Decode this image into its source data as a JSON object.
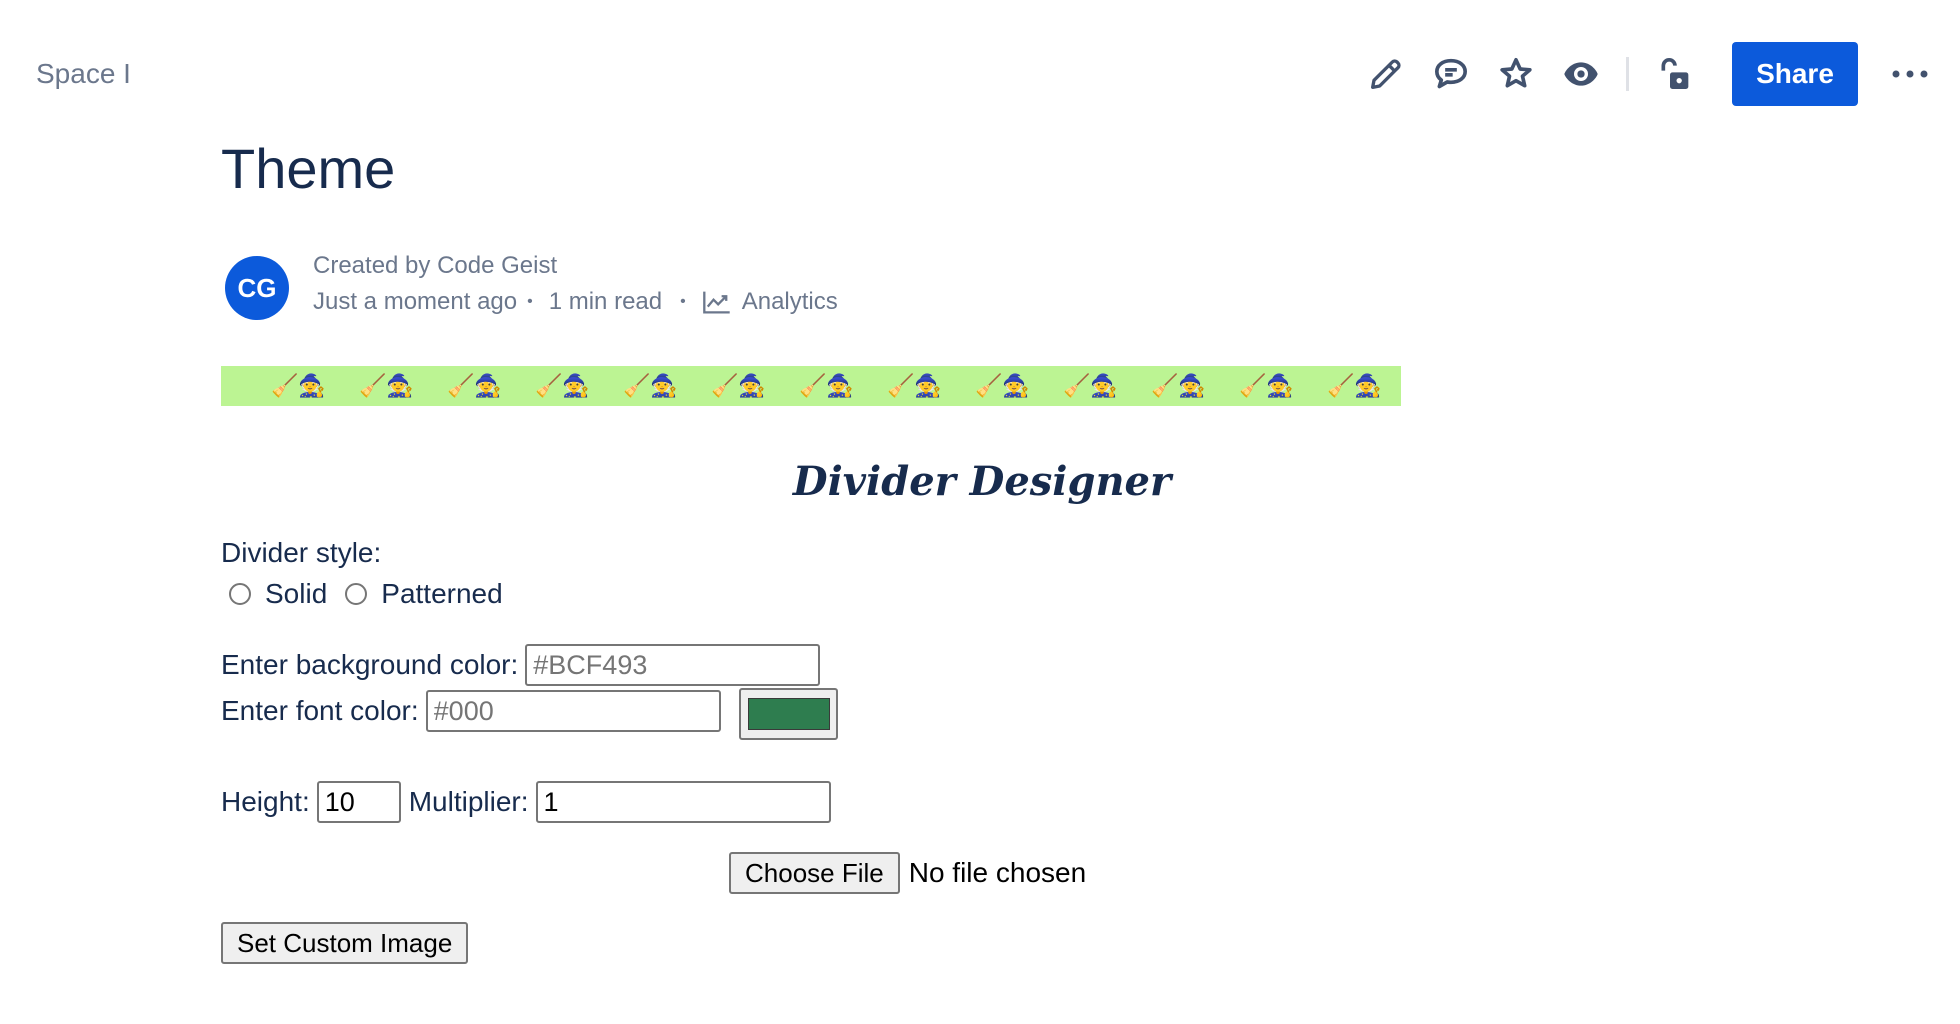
{
  "header": {
    "space_name": "Space I",
    "share_label": "Share",
    "share_color": "#0c5adb",
    "icons": [
      "edit-icon",
      "comment-icon",
      "star-icon",
      "watch-icon",
      "unlock-icon",
      "more-icon"
    ]
  },
  "page": {
    "title": "Theme"
  },
  "byline": {
    "avatar_initials": "CG",
    "created_by": "Created by Code Geist",
    "updated": "Just a moment ago",
    "separator": "•",
    "read_time": "1 min read",
    "analytics_label": "Analytics"
  },
  "divider_banner": {
    "background_color": "#BCF493",
    "motif": "🧹🧙",
    "motif_icon": "broom-witch-icon",
    "repeat_count": 13
  },
  "designer": {
    "title": "Divider Designer",
    "style_label": "Divider style:",
    "style_options": [
      "Solid",
      "Patterned"
    ],
    "bg_label": "Enter background color:",
    "bg_placeholder": "#BCF493",
    "font_label": "Enter font color:",
    "font_placeholder": "#000",
    "font_swatch_color": "#2e7d4f",
    "height_label": "Height:",
    "height_value": "10",
    "multiplier_label": "Multiplier:",
    "multiplier_value": "1",
    "choose_file_label": "Choose File",
    "file_status": "No file chosen",
    "set_image_label": "Set Custom Image"
  }
}
